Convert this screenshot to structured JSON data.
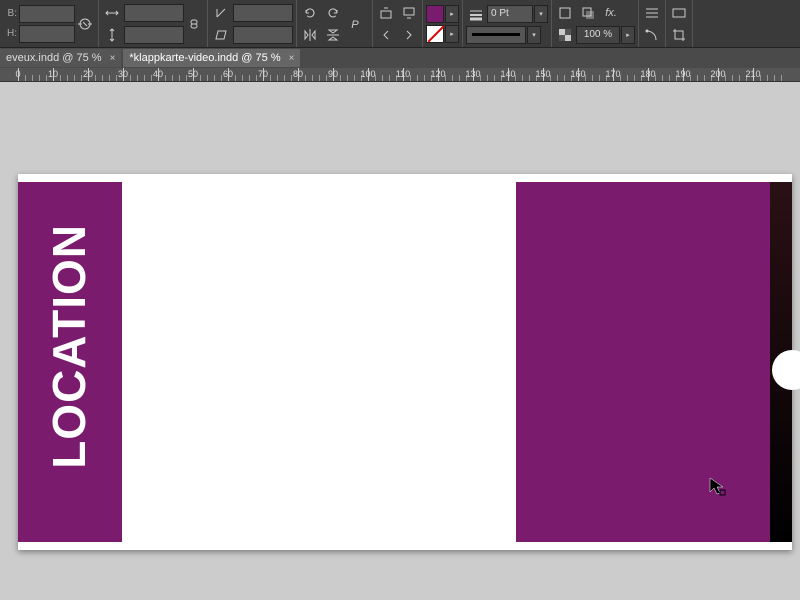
{
  "toolbar": {
    "b_label": "B:",
    "h_label": "H:",
    "b_value": "",
    "h_value": "",
    "scale_x": "",
    "scale_y": "",
    "rotate": "",
    "shear": "",
    "stroke_weight": "0 Pt",
    "opacity": "100 %"
  },
  "tabs": [
    {
      "label": "eveux.indd @ 75 %",
      "active": false
    },
    {
      "label": "*klappkarte-video.indd @ 75 %",
      "active": true
    }
  ],
  "ruler": {
    "ticks": [
      "0",
      "10",
      "20",
      "30",
      "40",
      "50",
      "60",
      "70",
      "80",
      "90",
      "100",
      "110",
      "120",
      "130",
      "140",
      "150",
      "160",
      "170",
      "180",
      "190",
      "200",
      "210"
    ]
  },
  "document": {
    "sidebar_title": "LOCATION"
  },
  "colors": {
    "accent": "#7a1b6e"
  }
}
